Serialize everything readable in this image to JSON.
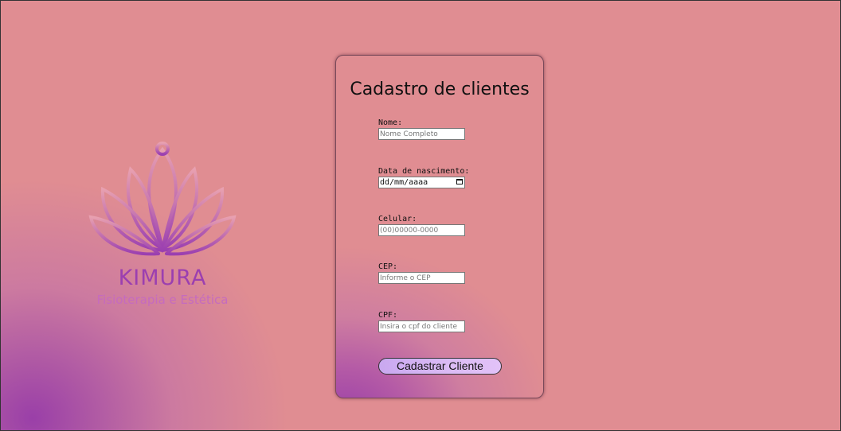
{
  "brand": {
    "logo_icon": "lotus-icon",
    "name": "KIMURA",
    "tagline": "Fisioterapia e Estética",
    "colors": {
      "primary": "#9b3fb0",
      "secondary": "#c56bbf",
      "background": "#e08d92"
    }
  },
  "form": {
    "title": "Cadastro de clientes",
    "fields": {
      "nome": {
        "label": "Nome:",
        "placeholder": "Nome Completo"
      },
      "nascimento": {
        "label": "Data de nascimento:",
        "value": "dd/mm/aaaa",
        "icon": "calendar-icon"
      },
      "celular": {
        "label": "Celular:",
        "placeholder": "(00)00000-0000"
      },
      "cep": {
        "label": "CEP:",
        "placeholder": "Informe o CEP"
      },
      "cpf": {
        "label": "CPF:",
        "placeholder": "Insira o cpf do cliente"
      }
    },
    "submit_label": "Cadastrar Cliente"
  }
}
